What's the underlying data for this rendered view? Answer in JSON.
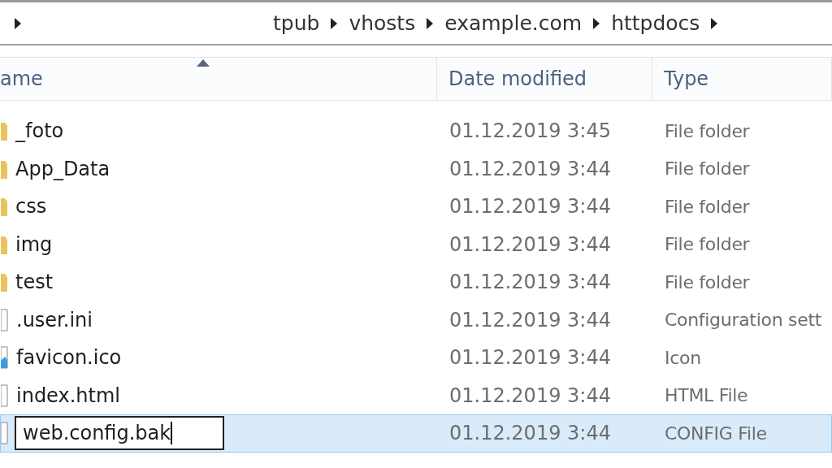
{
  "breadcrumb": [
    "tpub",
    "vhosts",
    "example.com",
    "httpdocs"
  ],
  "columns": [
    {
      "label": "ame",
      "sorted": true
    },
    {
      "label": "Date modified",
      "sorted": false
    },
    {
      "label": "Type",
      "sorted": false
    }
  ],
  "rows": [
    {
      "kind": "folder",
      "name": "_foto",
      "date": "01.12.2019 3:45",
      "type": "File folder",
      "selected": false,
      "editing": false
    },
    {
      "kind": "folder",
      "name": "App_Data",
      "date": "01.12.2019 3:44",
      "type": "File folder",
      "selected": false,
      "editing": false
    },
    {
      "kind": "folder",
      "name": "css",
      "date": "01.12.2019 3:44",
      "type": "File folder",
      "selected": false,
      "editing": false
    },
    {
      "kind": "folder",
      "name": "img",
      "date": "01.12.2019 3:44",
      "type": "File folder",
      "selected": false,
      "editing": false
    },
    {
      "kind": "folder",
      "name": "test",
      "date": "01.12.2019 3:44",
      "type": "File folder",
      "selected": false,
      "editing": false
    },
    {
      "kind": "file",
      "name": ".user.ini",
      "date": "01.12.2019 3:44",
      "type": "Configuration sett",
      "selected": false,
      "editing": false
    },
    {
      "kind": "image",
      "name": "favicon.ico",
      "date": "01.12.2019 3:44",
      "type": "Icon",
      "selected": false,
      "editing": false
    },
    {
      "kind": "file",
      "name": "index.html",
      "date": "01.12.2019 3:44",
      "type": "HTML File",
      "selected": false,
      "editing": false
    },
    {
      "kind": "file",
      "name": "web.config.bak",
      "date": "01.12.2019 3:44",
      "type": "CONFIG File",
      "selected": true,
      "editing": true
    }
  ]
}
